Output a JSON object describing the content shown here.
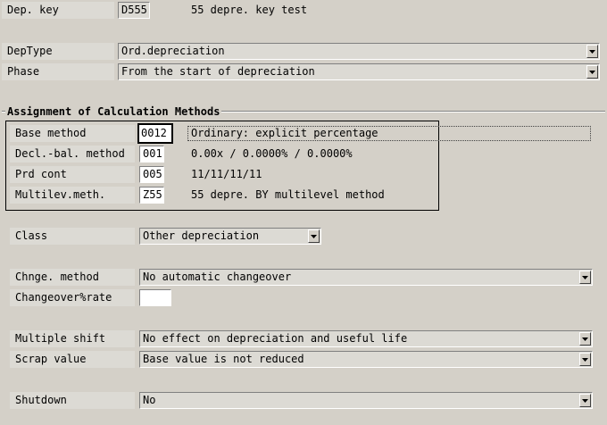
{
  "header": {
    "dep_key_label": "Dep. key",
    "dep_key_value": "D555",
    "dep_key_desc": "55 depre. key test"
  },
  "top_fields": {
    "deptype_label": "DepType",
    "deptype_value": "Ord.depreciation",
    "phase_label": "Phase",
    "phase_value": "From the start of depreciation"
  },
  "calc_methods": {
    "group_title": "Assignment of Calculation Methods",
    "base_method_label": "Base method",
    "base_method_value": "0012",
    "base_method_desc": "Ordinary: explicit percentage",
    "decl_bal_label": "Decl.-bal. method",
    "decl_bal_value": "001",
    "decl_bal_desc": "0.00x / 0.0000% / 0.0000%",
    "prd_cont_label": "Prd cont",
    "prd_cont_value": "005",
    "prd_cont_desc": "11/11/11/11",
    "multilev_label": "Multilev.meth.",
    "multilev_value": "Z55",
    "multilev_desc": "55 depre. BY multilevel method"
  },
  "other": {
    "class_label": "Class",
    "class_value": "Other depreciation",
    "chnge_method_label": "Chnge. method",
    "chnge_method_value": "No automatic changeover",
    "changeover_rate_label": "Changeover%rate",
    "changeover_rate_value": "",
    "multiple_shift_label": "Multiple shift",
    "multiple_shift_value": "No effect on depreciation and useful life",
    "scrap_value_label": "Scrap value",
    "scrap_value_value": "Base value is not reduced",
    "shutdown_label": "Shutdown",
    "shutdown_value": "No"
  }
}
